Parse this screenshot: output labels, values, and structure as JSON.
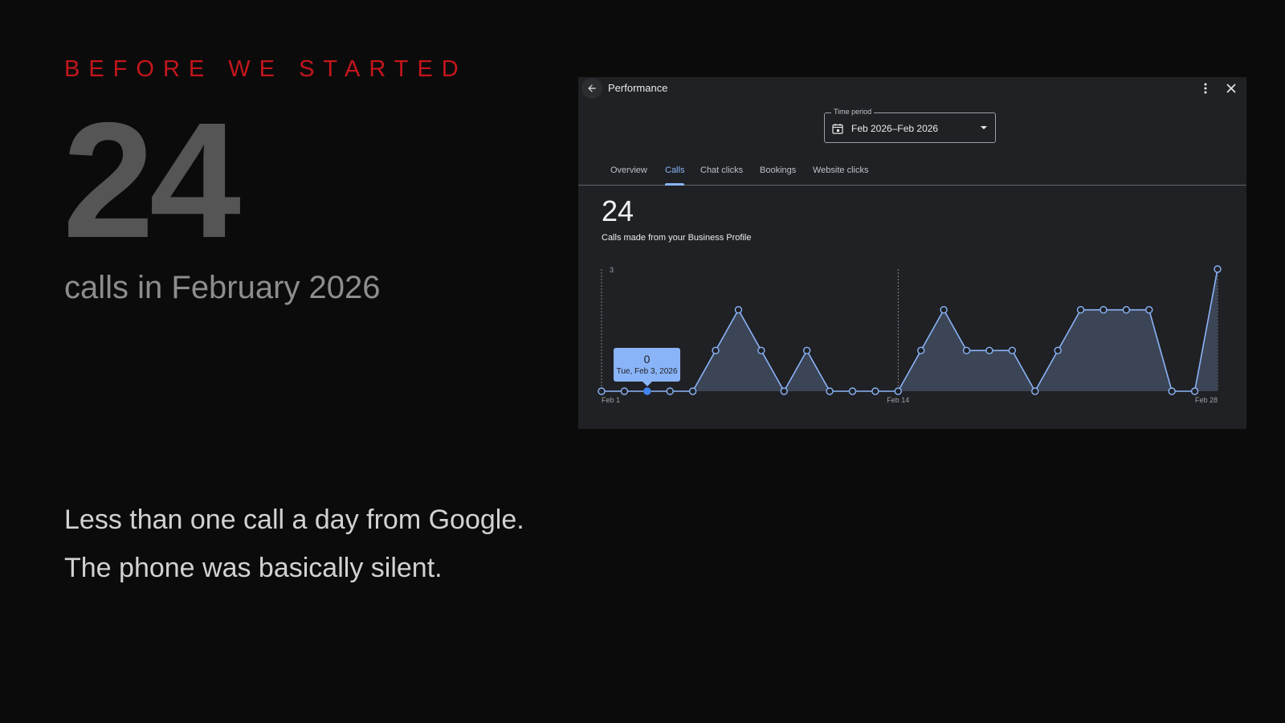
{
  "slide": {
    "eyebrow": "BEFORE WE STARTED",
    "big_number": "24",
    "subline": "calls in February 2026",
    "body_line_1": "Less than one call a day from Google.",
    "body_line_2": "The phone was basically silent."
  },
  "panel": {
    "title": "Performance",
    "back_icon": "arrow-back-icon",
    "more_icon": "more-vert-icon",
    "close_icon": "close-icon",
    "time_period": {
      "legend": "Time period",
      "value": "Feb 2026–Feb 2026",
      "icon": "calendar-icon"
    },
    "tabs": [
      {
        "label": "Overview",
        "active": false
      },
      {
        "label": "Calls",
        "active": true
      },
      {
        "label": "Chat clicks",
        "active": false
      },
      {
        "label": "Bookings",
        "active": false
      },
      {
        "label": "Website clicks",
        "active": false
      }
    ],
    "metric": {
      "value": "24",
      "label": "Calls made from your Business Profile"
    },
    "tooltip": {
      "value": "0",
      "date": "Tue, Feb 3, 2026"
    }
  },
  "chart_data": {
    "type": "area",
    "x": [
      1,
      2,
      3,
      4,
      5,
      6,
      7,
      8,
      9,
      10,
      11,
      12,
      13,
      14,
      15,
      16,
      17,
      18,
      19,
      20,
      21,
      22,
      23,
      24,
      25,
      26,
      27,
      28
    ],
    "values": [
      0,
      0,
      0,
      0,
      0,
      1,
      2,
      1,
      0,
      1,
      0,
      0,
      0,
      0,
      1,
      2,
      1,
      1,
      1,
      0,
      1,
      2,
      2,
      2,
      2,
      0,
      0,
      3
    ],
    "ylim": [
      0,
      3
    ],
    "y_ticks": [
      "3"
    ],
    "x_ticks": [
      {
        "x": 1,
        "label": "Feb 1"
      },
      {
        "x": 14,
        "label": "Feb 14"
      },
      {
        "x": 28,
        "label": "Feb 28"
      }
    ],
    "highlight_x": 3,
    "colors": {
      "line": "#8ab4f8",
      "fill": "#3c4556",
      "highlight": "#4285f4"
    }
  }
}
